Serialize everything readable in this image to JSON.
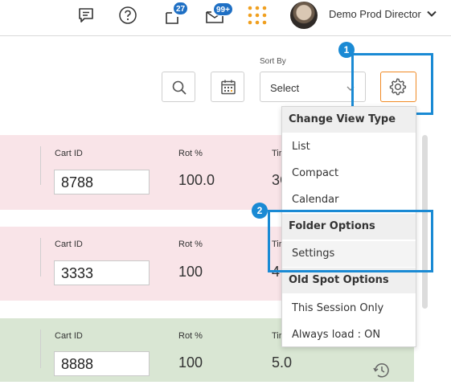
{
  "header": {
    "notifications_badge": "27",
    "messages_badge": "99+",
    "user_name": "Demo Prod Director",
    "icons": [
      "chat-icon",
      "help-icon",
      "notifications-icon",
      "messages-icon",
      "apps-grid-icon",
      "avatar",
      "chevron-down-icon"
    ]
  },
  "toolbar": {
    "sort_by_label": "Sort By",
    "sort_by_value": "Select"
  },
  "annotations": {
    "step1": "1",
    "step2": "2"
  },
  "cards": [
    {
      "cart_id_label": "Cart ID",
      "cart_id": "8788",
      "rot_label": "Rot %",
      "rot": "100.0",
      "time_label": "Tir",
      "time": "3C",
      "bg": "#f9e4e8"
    },
    {
      "cart_id_label": "Cart ID",
      "cart_id": "3333",
      "rot_label": "Rot %",
      "rot": "100",
      "time_label": "Tir",
      "time": "4",
      "bg": "#f9e4e8"
    },
    {
      "cart_id_label": "Cart ID",
      "cart_id": "8888",
      "rot_label": "Rot %",
      "rot": "100",
      "time_label": "Tir",
      "time": "5.0",
      "bg": "#d9e6d3"
    }
  ],
  "menu": {
    "sections": [
      {
        "header": "Change View Type",
        "items": [
          "List",
          "Compact",
          "Calendar"
        ]
      },
      {
        "header": "Folder Options",
        "items": [
          "Settings"
        ]
      },
      {
        "header": "Old Spot Options",
        "items": [
          "This Session Only",
          "Always load : ON"
        ]
      }
    ]
  },
  "colors": {
    "accent_blue": "#1a8ad4",
    "badge_blue": "#1e6fc4",
    "gear_orange": "#f08a24",
    "apps_orange": "#f0a020",
    "card_pink": "#f9e4e8",
    "card_green": "#d9e6d3"
  }
}
